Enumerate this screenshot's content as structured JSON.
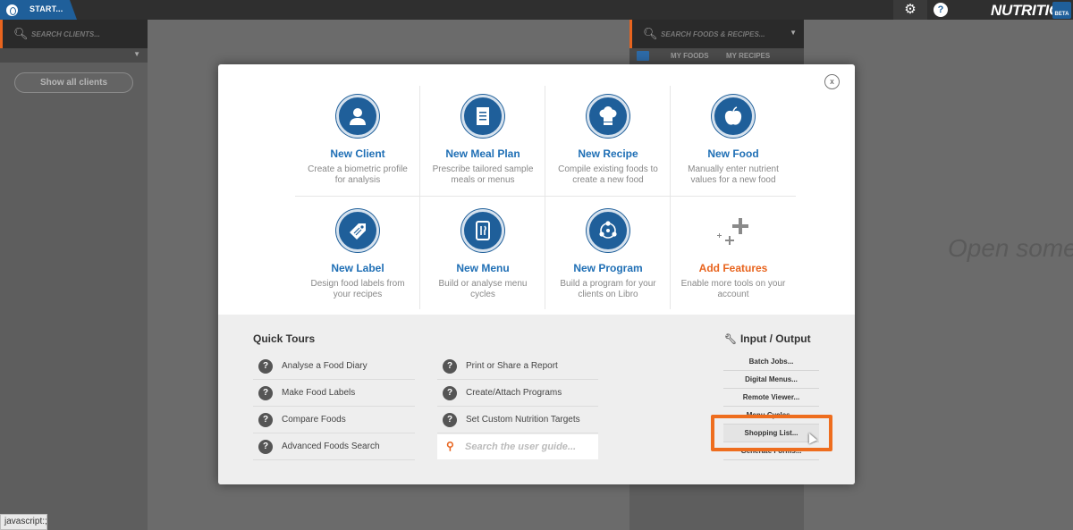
{
  "topbar": {
    "start_label": "START...",
    "brand": "NUTRITICS",
    "beta": "BETA",
    "help_label": "?"
  },
  "left_panel": {
    "search_placeholder": "SEARCH CLIENTS...",
    "show_all": "Show all clients"
  },
  "right_panel": {
    "search_placeholder": "SEARCH FOODS & RECIPES...",
    "tabs": [
      "MY FOODS",
      "MY RECIPES"
    ],
    "open_text": "Open somet"
  },
  "status_tip": "javascript:;",
  "modal": {
    "close_label": "x",
    "features": [
      {
        "title": "New Client",
        "desc": "Create a biometric profile for analysis",
        "icon": "user-icon"
      },
      {
        "title": "New Meal Plan",
        "desc": "Prescribe tailored sample meals or menus",
        "icon": "document-icon"
      },
      {
        "title": "New Recipe",
        "desc": "Compile existing foods to create a new food",
        "icon": "chef-hat-icon"
      },
      {
        "title": "New Food",
        "desc": "Manually enter nutrient values for a new food",
        "icon": "apple-icon"
      },
      {
        "title": "New Label",
        "desc": "Design food labels from your recipes",
        "icon": "tag-icon"
      },
      {
        "title": "New Menu",
        "desc": "Build or analyse menu cycles",
        "icon": "tablet-utensils-icon"
      },
      {
        "title": "New Program",
        "desc": "Build a program for your clients on Libro",
        "icon": "network-icon"
      },
      {
        "title": "Add Features",
        "desc": "Enable more tools on your account",
        "icon": "plus-icon"
      }
    ],
    "quick_tours": {
      "title": "Quick Tours",
      "col1": [
        "Analyse a Food Diary",
        "Make Food Labels",
        "Compare Foods",
        "Advanced Foods Search"
      ],
      "col2": [
        "Print or Share a Report",
        "Create/Attach Programs",
        "Set Custom Nutrition Targets"
      ],
      "search_placeholder": "Search the user guide..."
    },
    "io": {
      "title": "Input / Output",
      "items": [
        "Batch Jobs...",
        "Digital Menus...",
        "Remote Viewer...",
        "Menu Cycles...",
        "Shopping List...",
        "Generate Forms..."
      ]
    }
  },
  "colors": {
    "accent_blue": "#1f5f9a",
    "link_blue": "#1f6fb5",
    "accent_orange": "#e8641e"
  }
}
